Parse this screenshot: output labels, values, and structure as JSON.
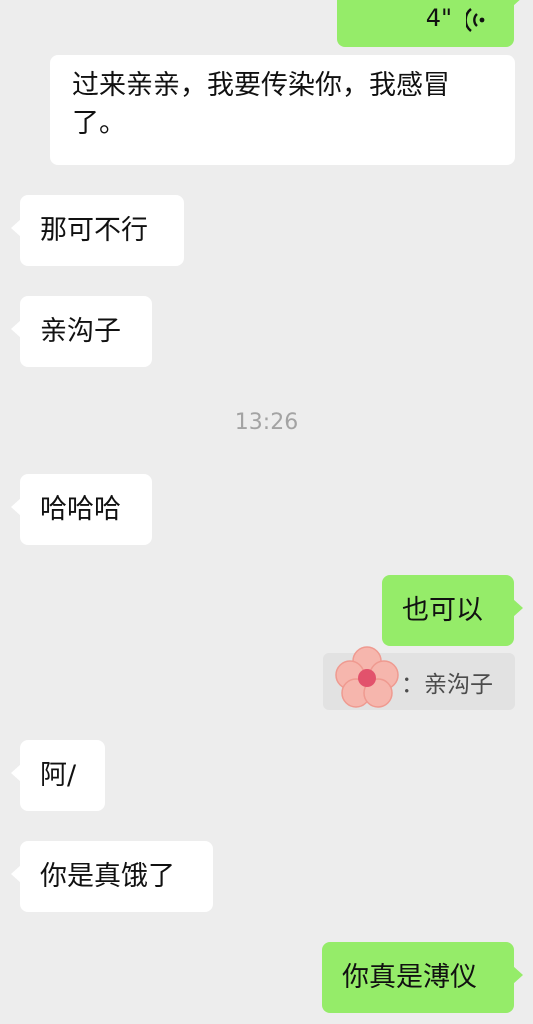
{
  "messages": [
    {
      "id": "m0",
      "side": "right",
      "type": "voice",
      "duration": "4\"",
      "icon": "voice-wave-icon"
    },
    {
      "id": "m1",
      "side": "left",
      "text": "过来亲亲，我要传染你，我感冒了。"
    },
    {
      "id": "m2",
      "side": "left",
      "text": "那可不行"
    },
    {
      "id": "m3",
      "side": "left",
      "text": "亲沟子"
    },
    {
      "id": "m4",
      "side": "left",
      "text": "哈哈哈"
    },
    {
      "id": "m5",
      "side": "right",
      "text": "也可以"
    },
    {
      "id": "m6",
      "side": "left",
      "text": "阿/"
    },
    {
      "id": "m7",
      "side": "left",
      "text": "你是真饿了"
    },
    {
      "id": "m8",
      "side": "right",
      "text": "你真是溥仪"
    }
  ],
  "timestamp": "13:26",
  "quote": {
    "sender_sep": "：",
    "text": "亲沟子",
    "avatar": "flower-avatar-icon"
  },
  "colors": {
    "background": "#ededed",
    "incoming": "#ffffff",
    "outgoing": "#95ec69",
    "quote_bg": "#e2e2e2",
    "timestamp": "#a3a3a3"
  }
}
